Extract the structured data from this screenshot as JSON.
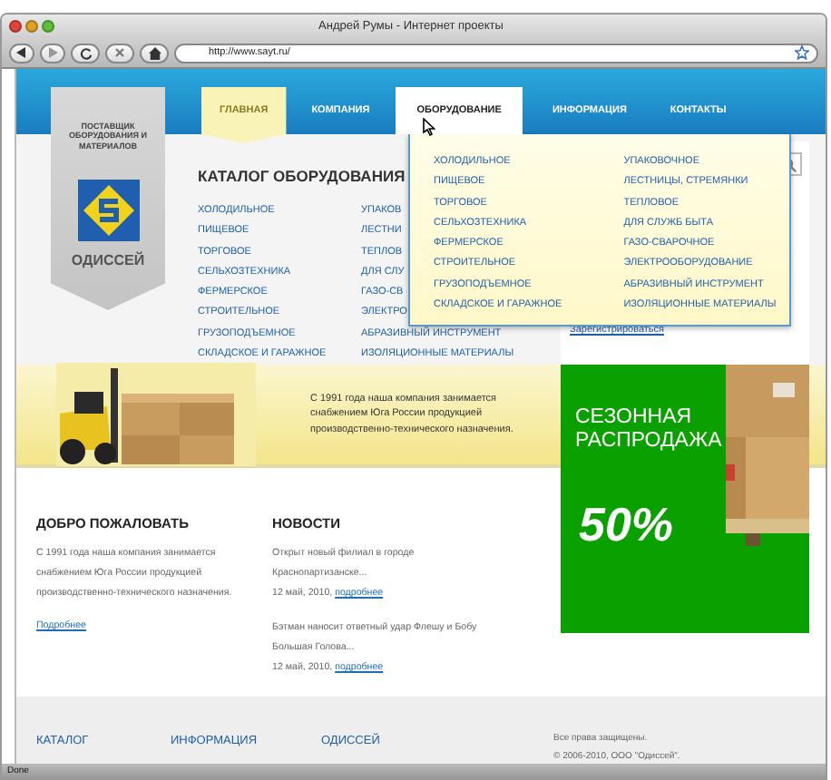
{
  "window": {
    "title": "Андрей Румы - Интернет проекты"
  },
  "toolbar": {
    "url": "http://www.sayt.ru/"
  },
  "logo": {
    "tagline": "ПОСТАВЩИК ОБОРУДОВАНИЯ И МАТЕРИАЛОВ",
    "name": "ОДИССЕЙ"
  },
  "nav": [
    {
      "label": "ГЛАВНАЯ",
      "selected": true,
      "hovered": false
    },
    {
      "label": "КОМПАНИЯ",
      "selected": false,
      "hovered": false
    },
    {
      "label": "ОБОРУДОВАНИЕ",
      "selected": false,
      "hovered": true
    },
    {
      "label": "ИНФОРМАЦИЯ",
      "selected": false,
      "hovered": false
    },
    {
      "label": "КОНТАКТЫ",
      "selected": false,
      "hovered": false
    }
  ],
  "dropdown": {
    "columns": [
      [
        "ХОЛОДИЛЬНОЕ",
        "ПИЩЕВОЕ",
        "ТОРГОВОЕ",
        "СЕЛЬХОЗТЕХНИКА",
        "ФЕРМЕРСКОЕ",
        "СТРОИТЕЛЬНОЕ",
        "ГРУЗОПОДЪЕМНОЕ",
        "СКЛАДСКОЕ И ГАРАЖНОЕ"
      ],
      [
        "УПАКОВОЧНОЕ",
        "ЛЕСТНИЦЫ, СТРЕМЯНКИ",
        "ТЕПЛОВОЕ",
        "ДЛЯ СЛУЖБ БЫТА",
        "ГАЗО-СВАРОЧНОЕ",
        "ЭЛЕКТРООБОРУДОВАНИЕ",
        "АБРАЗИВНЫЙ ИНСТРУМЕНТ",
        "ИЗОЛЯЦИОННЫЕ МАТЕРИАЛЫ"
      ]
    ]
  },
  "catalog": {
    "title": "КАТАЛОГ ОБОРУДОВАНИЯ",
    "columns": [
      [
        "ХОЛОДИЛЬНОЕ",
        "ПИЩЕВОЕ",
        "ТОРГОВОЕ",
        "СЕЛЬХОЗТЕХНИКА",
        "ФЕРМЕРСКОЕ",
        "СТРОИТЕЛЬНОЕ",
        "ГРУЗОПОДЪЕМНОЕ",
        "СКЛАДСКОЕ И ГАРАЖНОЕ"
      ],
      [
        "УПАКОВ",
        "ЛЕСТНИ",
        "ТЕПЛОВ",
        "ДЛЯ СЛУ",
        "ГАЗО-СВ",
        "ЭЛЕКТРО",
        "АБРАЗИВНЫЙ ИНСТРУМЕНТ",
        "ИЗОЛЯЦИОННЫЕ МАТЕРИАЛЫ"
      ]
    ]
  },
  "side_panel": {
    "link": "Зарегистрироваться"
  },
  "banner": {
    "text": "С 1991 года наша компания занимается снабжением Юга России продукцией производственно-технического назначения."
  },
  "sale": {
    "title": "СЕЗОННАЯ РАСПРОДАЖА",
    "discount": "50%"
  },
  "welcome": {
    "title": "ДОБРО ПОЖАЛОВАТЬ",
    "text": "С 1991 года наша компания занимается снабжением Юга России продукцией производственно-технического назначения.",
    "link": "Подробнее"
  },
  "news": {
    "title": "НОВОСТИ",
    "items": [
      {
        "text": "Открыт новый филиал в городе Краснопартизанске...",
        "date": "12 май, 2010,",
        "link": "подробнее"
      },
      {
        "text": "Бэтман наносит ответный удар Флешу и Бобу Большая Голова...",
        "date": "12 май, 2010,",
        "link": "подробнее"
      }
    ]
  },
  "footer": {
    "columns": [
      "КАТАЛОГ",
      "ИНФОРМАЦИЯ",
      "ОДИССЕЙ"
    ],
    "copyright": [
      "Все права защищены.",
      "© 2006-2010, ООО \"Одиссей\"."
    ]
  },
  "status_bar": "Done"
}
